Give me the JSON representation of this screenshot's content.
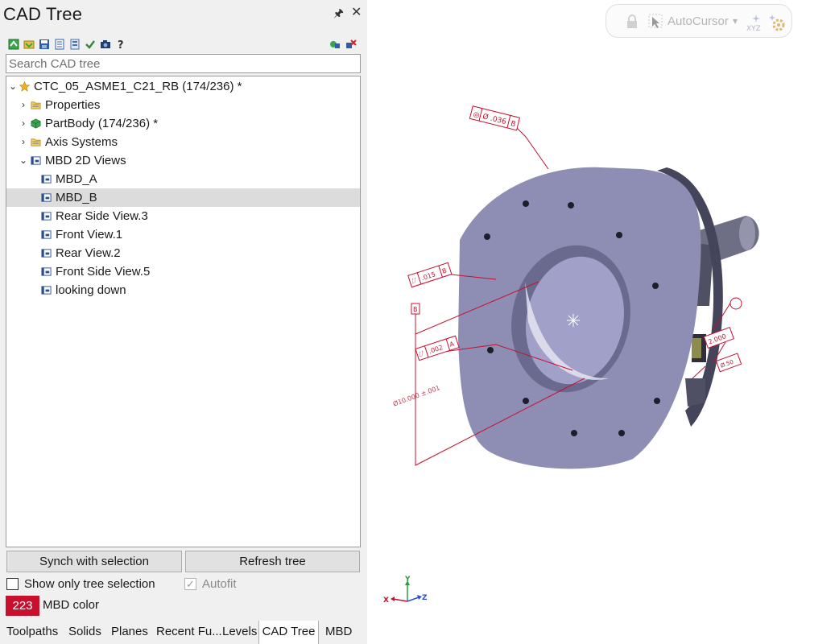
{
  "panel": {
    "title": "CAD Tree",
    "pin_glyph": "🖈",
    "close_glyph": "✕",
    "search_placeholder": "Search CAD tree"
  },
  "toolbar_icons": [
    "expand-tree-icon",
    "collapse-tree-icon",
    "save-icon",
    "document-icon",
    "list-icon",
    "checkmark-icon",
    "camera-icon",
    "help-icon",
    "group-icon",
    "remove-icon"
  ],
  "tree": {
    "items": [
      {
        "label": "CTC_05_ASME1_C21_RB (174/236) *",
        "expander": "⌄",
        "icon": "star-icon"
      },
      {
        "label": "Properties",
        "expander": "›",
        "icon": "folder-icon"
      },
      {
        "label": "PartBody (174/236) *",
        "expander": "›",
        "icon": "cube-icon"
      },
      {
        "label": "Axis Systems",
        "expander": "›",
        "icon": "folder-icon"
      },
      {
        "label": "MBD 2D Views",
        "expander": "⌄",
        "icon": "view-icon"
      },
      {
        "label": "MBD_A",
        "icon": "view-icon"
      },
      {
        "label": "MBD_B",
        "icon": "view-icon"
      },
      {
        "label": "Rear Side View.3",
        "icon": "view-icon"
      },
      {
        "label": "Front View.1",
        "icon": "view-icon"
      },
      {
        "label": "Rear View.2",
        "icon": "view-icon"
      },
      {
        "label": "Front Side View.5",
        "icon": "view-icon"
      },
      {
        "label": "looking down",
        "icon": "view-icon"
      }
    ]
  },
  "buttons": {
    "synch": "Synch with selection",
    "refresh": "Refresh tree"
  },
  "options": {
    "show_only_selection": "Show only tree selection",
    "autofit": "Autofit",
    "autofit_mark": "✓",
    "mbd_color_value": "223",
    "mbd_color_label": "MBD color",
    "mbd_color_hex": "#c8102e"
  },
  "tabs": [
    "Toolpaths",
    "Solids",
    "Planes",
    "Recent Fu...",
    "Levels",
    "CAD Tree",
    "MBD"
  ],
  "viewport": {
    "autocursor_label": "AutoCursor",
    "autocursor_caret": "▾",
    "axes": {
      "x": "X",
      "y": "Y",
      "z": "Z"
    },
    "gdt_labels": [
      "Ø .036",
      "B",
      ".015",
      "B",
      ".002",
      "A",
      "Ø10.000 ±.001",
      "2.000",
      "Ø.50"
    ]
  }
}
